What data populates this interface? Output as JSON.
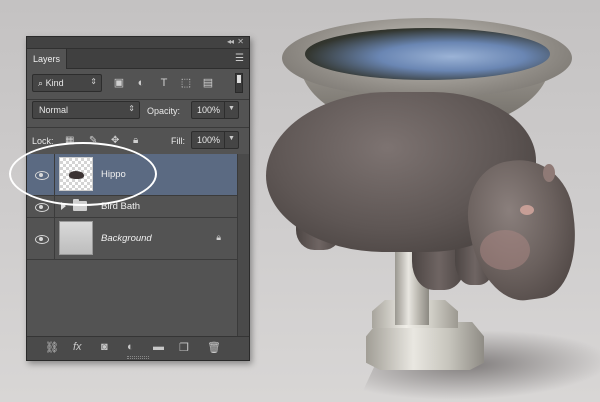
{
  "panel": {
    "tab_label": "Layers",
    "collapse_glyph": "◂◂",
    "close_glyph": "✕",
    "menu_glyph": "☰",
    "filter": {
      "kind_label": "Kind",
      "search_glyph": "⌕",
      "icons": [
        "image-filter-icon",
        "adjustment-filter-icon",
        "type-filter-icon",
        "shape-filter-icon",
        "smart-object-filter-icon"
      ]
    },
    "blend_mode": "Normal",
    "opacity_label": "Opacity:",
    "opacity_value": "100%",
    "lock_label": "Lock:",
    "fill_label": "Fill:",
    "fill_value": "100%",
    "layers": [
      {
        "name": "Hippo",
        "selected": true,
        "visible": true
      },
      {
        "name": "Bird Bath",
        "type": "group",
        "visible": true
      },
      {
        "name": "Background",
        "locked": true,
        "visible": true
      }
    ],
    "footer_icons": [
      "link-layers-icon",
      "fx-icon",
      "add-mask-icon",
      "new-fill-adjustment-icon",
      "new-group-icon",
      "new-layer-icon",
      "delete-layer-icon"
    ],
    "fx_label": "fx"
  },
  "colors": {
    "panel_bg": "#535353",
    "selected_row": "#5b6a82",
    "highlight_circle": "#ffffff"
  }
}
